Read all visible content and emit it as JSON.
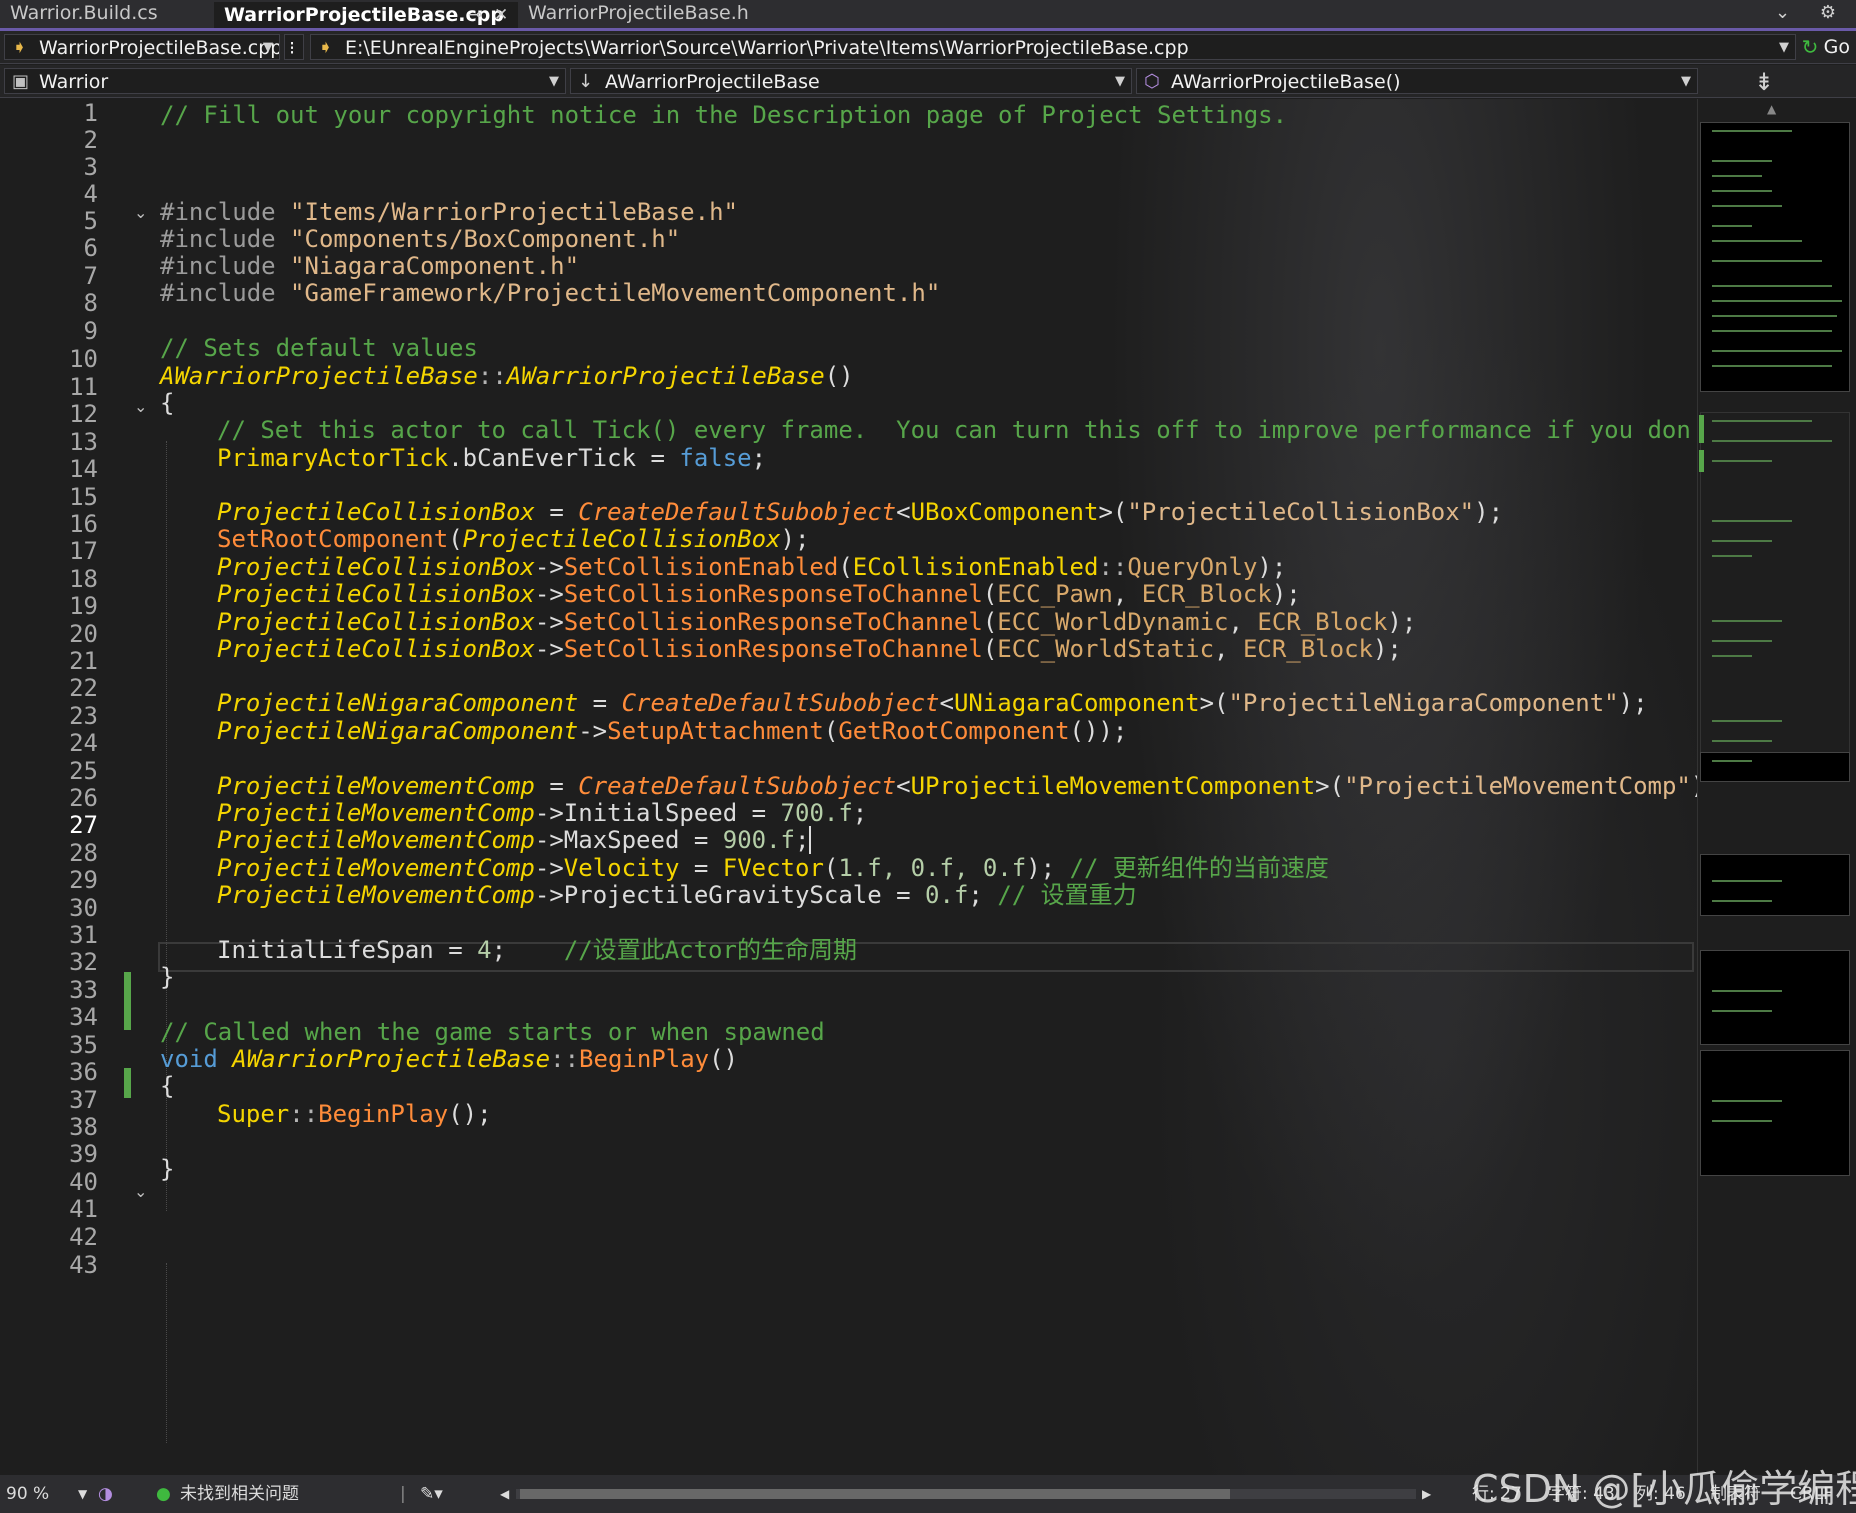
{
  "tabs": [
    {
      "label": "Warrior.Build.cs",
      "active": false
    },
    {
      "label": "WarriorProjectileBase.cpp",
      "active": true
    },
    {
      "label": "WarriorProjectileBase.h",
      "active": false
    }
  ],
  "tab_icons": {
    "pin": "⊸",
    "close": "✕",
    "right": "⌄ ⚙"
  },
  "nav": {
    "file_combo": "WarriorProjectileBase.cpp",
    "path": "E:\\EUnrealEngineProjects\\Warrior\\Source\\Warrior\\Private\\Items\\WarriorProjectileBase.cpp",
    "go_label": "Go",
    "project_combo": "Warrior",
    "class_combo": "AWarriorProjectileBase",
    "member_combo": "AWarriorProjectileBase()"
  },
  "editor": {
    "current_line": 27,
    "lines": [
      "1",
      "2",
      "3",
      "4",
      "5",
      "6",
      "7",
      "8",
      "9",
      "10",
      "11",
      "12",
      "13",
      "14",
      "15",
      "16",
      "17",
      "18",
      "19",
      "20",
      "21",
      "22",
      "23",
      "24",
      "25",
      "26",
      "27",
      "28",
      "29",
      "30",
      "31",
      "32",
      "33",
      "34",
      "35",
      "36",
      "37",
      "38",
      "39",
      "40",
      "41",
      "42",
      "43"
    ]
  },
  "code": {
    "l1": "// Fill out your copyright notice in the Description page of Project Settings.",
    "l4_kw": "#include",
    "l4_str": "\"Items/WarriorProjectileBase.h\"",
    "l5_kw": "#include",
    "l5_str": "\"Components/BoxComponent.h\"",
    "l6_kw": "#include",
    "l6_str": "\"NiagaraComponent.h\"",
    "l7_kw": "#include",
    "l7_str": "\"GameFramework/ProjectileMovementComponent.h\"",
    "l9": "// Sets default values",
    "class_name": "AWarriorProjectileBase",
    "scope": "::",
    "ctor_parens": "()",
    "open_brace": "{",
    "close_brace": "}",
    "l12": "// Set this actor to call Tick() every frame.  You can turn this off to improve performance if you don't",
    "tick_obj": "PrimaryActorTick",
    "tick_member": ".bCanEverTick = ",
    "false_kw": "false",
    "semi": ";",
    "collision_box": "ProjectileCollisionBox",
    "create_default": "CreateDefaultSubobject",
    "ubox": "UBoxComponent",
    "box_name": "\"ProjectileCollisionBox\"",
    "set_root": "SetRootComponent",
    "set_coll_enabled": "SetCollisionEnabled",
    "ecollision_enabled": "ECollisionEnabled",
    "query_only": "QueryOnly",
    "set_resp": "SetCollisionResponseToChannel",
    "ecc_pawn": "ECC_Pawn",
    "ecc_wdyn": "ECC_WorldDynamic",
    "ecc_wstat": "ECC_WorldStatic",
    "ecr_block": "ECR_Block",
    "niagara_comp": "ProjectileNigaraComponent",
    "uniagara": "UNiagaraComponent",
    "niagara_name": "\"ProjectileNigaraComponent\"",
    "setup_attach": "SetupAttachment",
    "get_root": "GetRootComponent",
    "move_comp": "ProjectileMovementComp",
    "upmc": "UProjectileMovementComponent",
    "move_name": "\"ProjectileMovementComp\"",
    "initial_speed": "InitialSpeed",
    "v700": "700.f",
    "max_speed": "MaxSpeed",
    "v900": "900.f",
    "velocity": "Velocity",
    "fvector": "FVector",
    "vec_args": "1.f, 0.f, 0.f",
    "cm_velocity": "// 更新组件的当前速度",
    "gravity": "ProjectileGravityScale",
    "v0": "0.f",
    "cm_gravity": "// 设置重力",
    "lifespan": "InitialLifeSpan",
    "v4": "4",
    "cm_lifespan": "//设置此Actor的生命周期",
    "l34": "// Called when the game starts or when spawned",
    "void_kw": "void",
    "begin_play": "BeginPlay",
    "super": "Super"
  },
  "status": {
    "zoom": "90 %",
    "issues": "未找到相关问题",
    "row": "行: 27",
    "char": "字符: 43",
    "col": "列: 46",
    "tabs_mode": "制表符",
    "line_end": "CRLF"
  },
  "watermark": "CSDN @[小瓜偷学编程]",
  "icons": [
    "file-icon",
    "arrow-icon",
    "project-icon",
    "class-icon",
    "method-icon",
    "go-icon",
    "split-icon",
    "check-icon",
    "brush-icon"
  ],
  "colors": {
    "background": "#1e1e1e",
    "comment": "#57a64a",
    "keyword": "#569cd6",
    "string": "#e0b88a",
    "type": "#f5d500",
    "function": "#ff8c3a",
    "accent": "#6a5aa8"
  }
}
